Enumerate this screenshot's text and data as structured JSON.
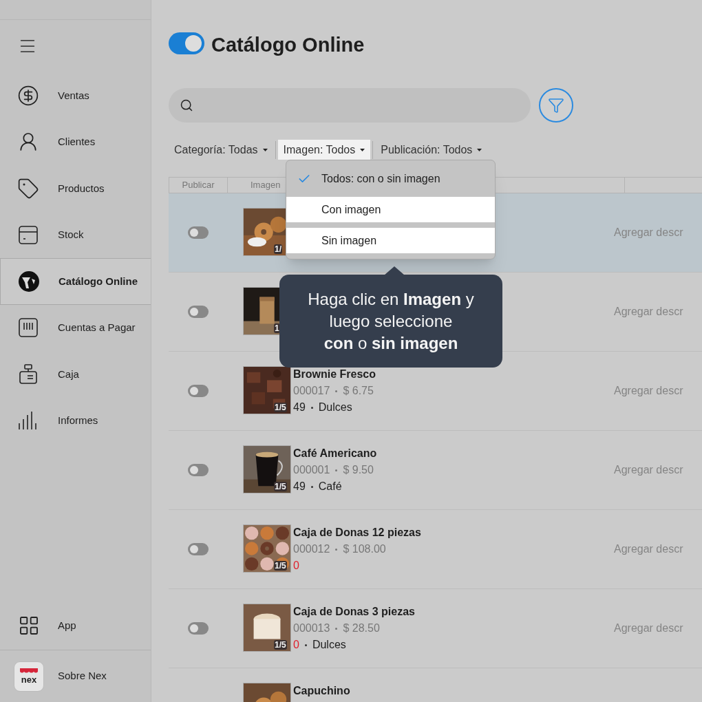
{
  "sidebar": {
    "items": [
      {
        "label": "Ventas",
        "selected": false
      },
      {
        "label": "Clientes",
        "selected": false
      },
      {
        "label": "Productos",
        "selected": false
      },
      {
        "label": "Stock",
        "selected": false
      },
      {
        "label": "Catálogo Online",
        "selected": true
      },
      {
        "label": "Cuentas a Pagar",
        "selected": false
      },
      {
        "label": "Caja",
        "selected": false
      },
      {
        "label": "Informes",
        "selected": false
      }
    ],
    "app": {
      "label": "App"
    },
    "about": {
      "logo_text": "nex",
      "label": "Sobre Nex"
    }
  },
  "header": {
    "title": "Catálogo Online"
  },
  "filters": [
    {
      "label": "Categoría: Todas",
      "active": false
    },
    {
      "label": "Imagen: Todos",
      "active": true
    },
    {
      "label": "Publicación: Todos",
      "active": false
    }
  ],
  "dropdown": {
    "options": [
      {
        "label": "Todos: con o sin imagen",
        "selected": true,
        "highlighted": false
      },
      {
        "label": "Con imagen",
        "selected": false,
        "highlighted": true
      },
      {
        "label": "Sin imagen",
        "selected": false,
        "highlighted": true
      }
    ]
  },
  "tooltip": {
    "lines": [
      "Haga clic en **Imagen** y",
      "luego seleccione",
      "**con** o **sin imagen**"
    ]
  },
  "table": {
    "columns": [
      "Publicar",
      "Imagen"
    ],
    "rows": [
      {
        "published": false,
        "selected": true,
        "counter": "1/",
        "description": "Agregar descr"
      },
      {
        "published": false,
        "selected": false,
        "counter": "1",
        "description": "Agregar descr"
      },
      {
        "published": false,
        "selected": false,
        "counter": "1/5",
        "name": "Brownie Fresco",
        "code": "000017",
        "price": "$ 6.75",
        "stock": "49",
        "out_of_stock": false,
        "category": "Dulces",
        "description": "Agregar descr"
      },
      {
        "published": false,
        "selected": false,
        "counter": "1/5",
        "name": "Café Americano",
        "code": "000001",
        "price": "$ 9.50",
        "stock": "49",
        "out_of_stock": false,
        "category": "Café",
        "description": "Agregar descr"
      },
      {
        "published": false,
        "selected": false,
        "counter": "1/5",
        "name": "Caja de Donas 12 piezas",
        "code": "000012",
        "price": "$ 108.00",
        "stock": "0",
        "out_of_stock": true,
        "description": "Agregar descr"
      },
      {
        "published": false,
        "selected": false,
        "counter": "1/5",
        "name": "Caja de Donas 3 piezas",
        "code": "000013",
        "price": "$ 28.50",
        "stock": "0",
        "out_of_stock": true,
        "category": "Dulces",
        "description": "Agregar descr"
      },
      {
        "name": "Capuchino"
      }
    ]
  }
}
